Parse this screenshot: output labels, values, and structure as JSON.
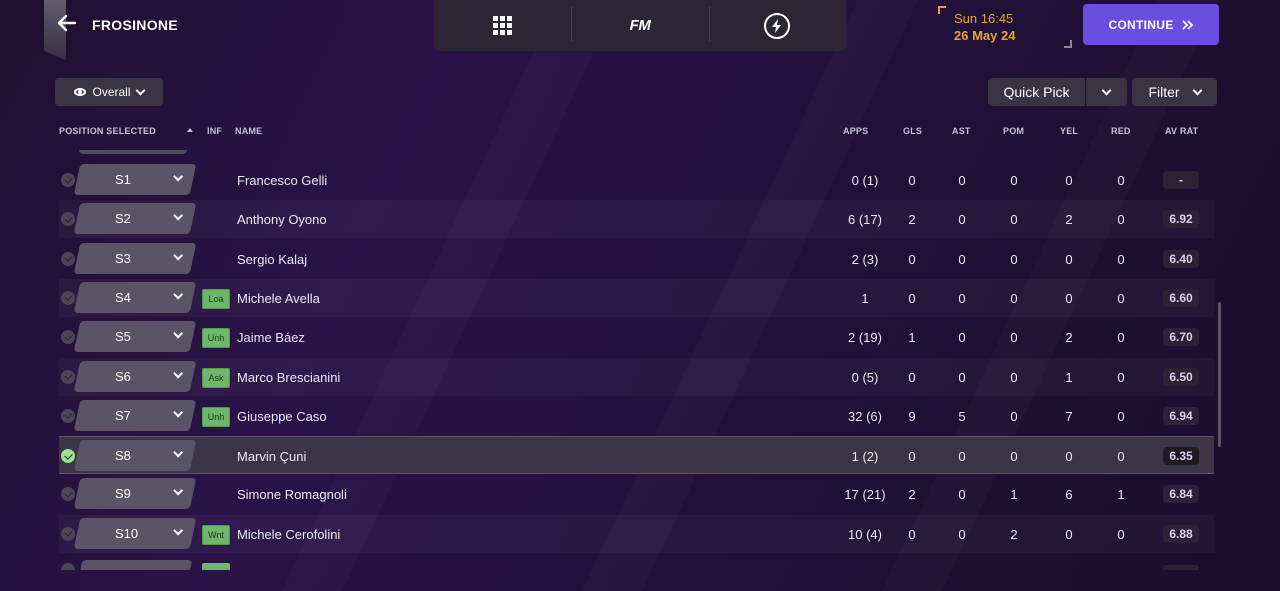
{
  "header": {
    "club_name": "FROSINONE",
    "date_time": "Sun 16:45",
    "date_day": "26 May 24",
    "continue_label": "CONTINUE",
    "fm_label": "FM"
  },
  "toolbar": {
    "view_label": "Overall",
    "quick_pick_label": "Quick Pick",
    "filter_label": "Filter"
  },
  "columns": {
    "position": "POSITION SELECTED",
    "inf": "INF",
    "name": "NAME",
    "apps": "APPS",
    "gls": "GLS",
    "ast": "AST",
    "pom": "POM",
    "yel": "YEL",
    "red": "RED",
    "avrat": "AV RAT"
  },
  "rows": [
    {
      "pos": "S1",
      "inf": "",
      "name": "Francesco Gelli",
      "apps": "0 (1)",
      "gls": "0",
      "ast": "0",
      "pom": "0",
      "yel": "0",
      "red": "0",
      "avrat": "-"
    },
    {
      "pos": "S2",
      "inf": "",
      "name": "Anthony Oyono",
      "apps": "6 (17)",
      "gls": "2",
      "ast": "0",
      "pom": "0",
      "yel": "2",
      "red": "0",
      "avrat": "6.92"
    },
    {
      "pos": "S3",
      "inf": "",
      "name": "Sergio Kalaj",
      "apps": "2 (3)",
      "gls": "0",
      "ast": "0",
      "pom": "0",
      "yel": "0",
      "red": "0",
      "avrat": "6.40"
    },
    {
      "pos": "S4",
      "inf": "Loa",
      "name": "Michele Avella",
      "apps": "1",
      "gls": "0",
      "ast": "0",
      "pom": "0",
      "yel": "0",
      "red": "0",
      "avrat": "6.60"
    },
    {
      "pos": "S5",
      "inf": "Unh",
      "name": "Jaime Báez",
      "apps": "2 (19)",
      "gls": "1",
      "ast": "0",
      "pom": "0",
      "yel": "2",
      "red": "0",
      "avrat": "6.70"
    },
    {
      "pos": "S6",
      "inf": "Ask",
      "name": "Marco Brescianini",
      "apps": "0 (5)",
      "gls": "0",
      "ast": "0",
      "pom": "0",
      "yel": "1",
      "red": "0",
      "avrat": "6.50"
    },
    {
      "pos": "S7",
      "inf": "Unh",
      "name": "Giuseppe Caso",
      "apps": "32 (6)",
      "gls": "9",
      "ast": "5",
      "pom": "0",
      "yel": "7",
      "red": "0",
      "avrat": "6.94"
    },
    {
      "pos": "S8",
      "inf": "",
      "name": "Marvin Çuni",
      "apps": "1 (2)",
      "gls": "0",
      "ast": "0",
      "pom": "0",
      "yel": "0",
      "red": "0",
      "avrat": "6.35"
    },
    {
      "pos": "S9",
      "inf": "",
      "name": "Simone Romagnoli",
      "apps": "17 (21)",
      "gls": "2",
      "ast": "0",
      "pom": "1",
      "yel": "6",
      "red": "1",
      "avrat": "6.84"
    },
    {
      "pos": "S10",
      "inf": "Wnt",
      "name": "Michele Cerofolini",
      "apps": "10 (4)",
      "gls": "0",
      "ast": "0",
      "pom": "2",
      "yel": "0",
      "red": "0",
      "avrat": "6.88"
    }
  ],
  "selected_row_index": 7,
  "colors": {
    "accent": "#6a4ee0",
    "date": "#e8a233",
    "inf_badge": "#6db66a",
    "selected_check": "#9be28f"
  },
  "icons": {
    "back": "arrow-left-icon",
    "grid": "grid-menu-icon",
    "bolt": "lightning-icon",
    "eye": "eye-icon",
    "continue": "double-chevron-right-icon"
  }
}
